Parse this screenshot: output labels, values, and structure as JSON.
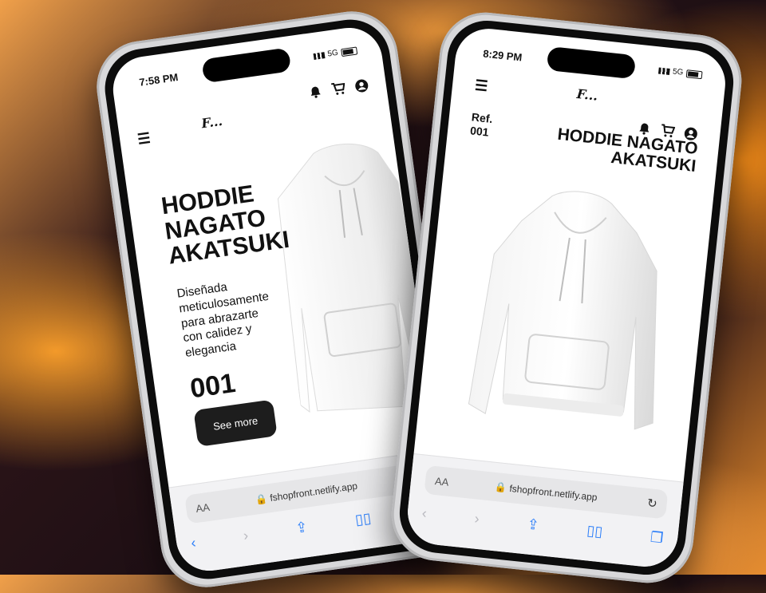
{
  "left_phone": {
    "time": "7:58 PM",
    "network": "5G",
    "logo": "F...",
    "title_lines": [
      "HODDIE",
      "NAGATO",
      "AKATSUKI"
    ],
    "description_lines": [
      "Diseñada",
      "meticulosamente",
      "para abrazarte",
      "con calidez y",
      "elegancia"
    ],
    "ref_number": "001",
    "cta_label": "See more",
    "url": "fshopfront.netlify.app",
    "aa_label": "AA"
  },
  "right_phone": {
    "time": "8:29 PM",
    "network": "5G",
    "logo": "F...",
    "ref_label": "Ref.",
    "ref_number": "001",
    "title_lines": [
      "HODDIE NAGATO",
      "AKATSUKI"
    ],
    "url": "fshopfront.netlify.app",
    "aa_label": "AA"
  },
  "icons": {
    "menu": "menu-icon",
    "bell": "bell-icon",
    "cart": "cart-icon",
    "account": "account-icon",
    "lock": "lock-icon",
    "reload": "reload-icon",
    "back": "back-icon",
    "forward": "forward-icon",
    "share": "share-icon",
    "bookmarks": "bookmarks-icon",
    "tabs": "tabs-icon"
  },
  "colors": {
    "accent": "#2d7ff9",
    "button": "#1d1d1d",
    "background_orange": "#f08a18",
    "background_dark": "#1e0f14"
  }
}
